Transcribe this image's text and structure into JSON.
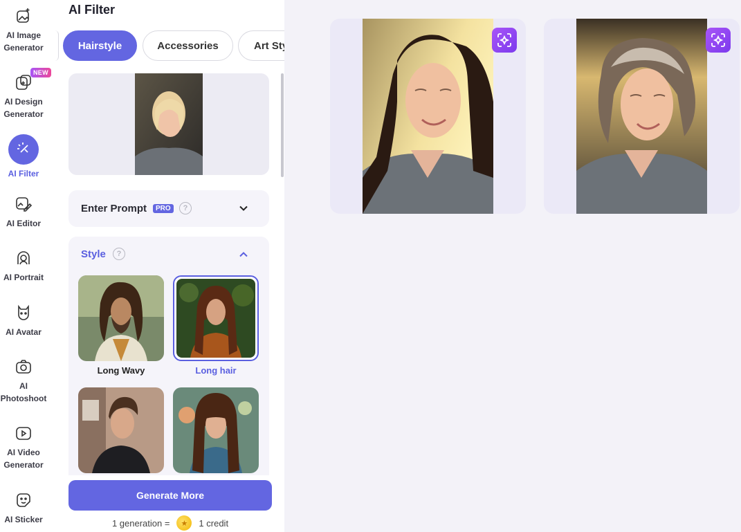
{
  "nav": {
    "items": [
      {
        "label": "AI Image Generator",
        "icon": "image-sparkle-icon"
      },
      {
        "label": "AI Design Generator",
        "icon": "design-plus-icon",
        "badge": "NEW"
      },
      {
        "label": "AI Filter",
        "icon": "magic-wand-icon",
        "active": true
      },
      {
        "label": "AI Editor",
        "icon": "edit-image-icon"
      },
      {
        "label": "AI Portrait",
        "icon": "portrait-icon"
      },
      {
        "label": "AI Avatar",
        "icon": "avatar-icon"
      },
      {
        "label": "AI Photoshoot",
        "icon": "camera-icon"
      },
      {
        "label": "AI Video Generator",
        "icon": "video-play-icon"
      },
      {
        "label": "AI Sticker",
        "icon": "sticker-icon"
      }
    ]
  },
  "panel": {
    "title": "AI Filter",
    "tabs": [
      "Hairstyle",
      "Accessories",
      "Art Sty"
    ],
    "active_tab": "Hairstyle",
    "prompt": {
      "label": "Enter Prompt",
      "badge": "PRO"
    },
    "style": {
      "label": "Style",
      "options": [
        {
          "name": "Long Wavy",
          "selected": false
        },
        {
          "name": "Long hair",
          "selected": true
        },
        {
          "name": "",
          "selected": false
        },
        {
          "name": "",
          "selected": false
        }
      ]
    },
    "generate_label": "Generate More",
    "credit": {
      "left": "1 generation =",
      "right": "1 credit"
    }
  },
  "colors": {
    "accent": "#6366e1",
    "accent_text": "#5a5fe0"
  }
}
